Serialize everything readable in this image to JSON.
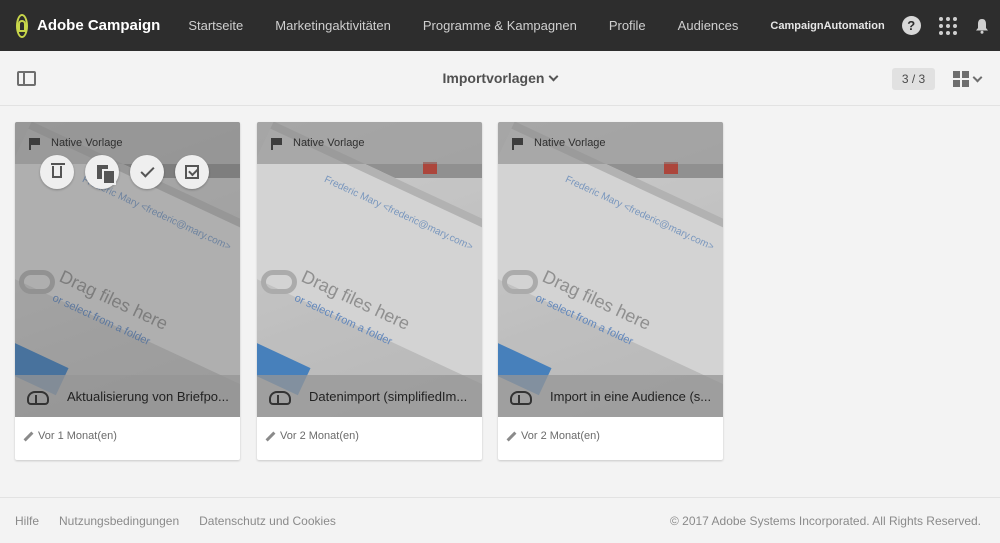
{
  "app": {
    "brand": "Adobe Campaign"
  },
  "nav": {
    "items": [
      "Startseite",
      "Marketingaktivitäten",
      "Programme & Kampagnen",
      "Profile",
      "Audiences"
    ],
    "account": "CampaignAutomation",
    "icons": [
      "help-icon",
      "apps-grid-icon",
      "bell-icon",
      "user-avatar-icon"
    ]
  },
  "toolbar": {
    "title": "Importvorlagen",
    "counter": "3 / 3"
  },
  "cards": [
    {
      "badge": "Native Vorlage",
      "title": "Aktualisierung von Briefpo...",
      "modified": "Vor 1 Monat(en)"
    },
    {
      "badge": "Native Vorlage",
      "title": "Datenimport (simplifiedIm...",
      "modified": "Vor 2 Monat(en)"
    },
    {
      "badge": "Native Vorlage",
      "title": "Import in eine Audience (s...",
      "modified": "Vor 2 Monat(en)"
    }
  ],
  "thumbnail": {
    "name": "Frederic Mary",
    "email": "<frederic@mary.com>",
    "drag": "Drag files here",
    "select": "or select from a folder",
    "ok": "OK"
  },
  "footer": {
    "links": [
      "Hilfe",
      "Nutzungsbedingungen",
      "Datenschutz und Cookies"
    ],
    "copyright": "© 2017 Adobe Systems Incorporated. All Rights Reserved."
  },
  "colors": {
    "topbar": "#2d2d2d",
    "logo_accent": "#c8d64a",
    "link_blue": "#3a86d4"
  }
}
